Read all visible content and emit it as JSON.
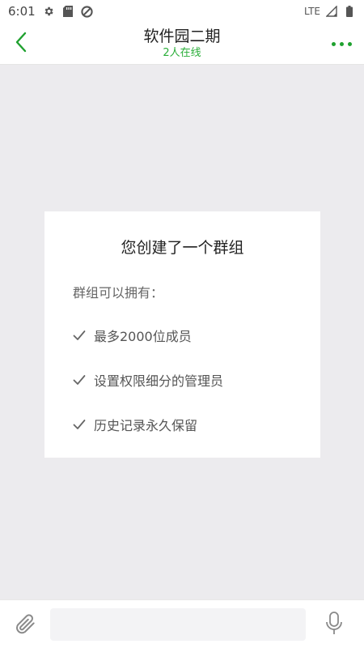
{
  "status_bar": {
    "time": "6:01",
    "network": "LTE",
    "icons": [
      "gear-icon",
      "sd-card-icon",
      "sync-icon",
      "signal-icon",
      "battery-icon"
    ]
  },
  "header": {
    "title": "软件园二期",
    "subtitle": "2人在线",
    "back_icon": "chevron-left-icon",
    "more_icon": "more-dots-icon",
    "accent_color": "#1fa12f"
  },
  "group_card": {
    "title": "您创建了一个群组",
    "intro": "群组可以拥有：",
    "features": [
      "最多2000位成员",
      "设置权限细分的管理员",
      "历史记录永久保留"
    ]
  },
  "input_bar": {
    "attach_icon": "paperclip-icon",
    "placeholder": "",
    "value": "",
    "mic_icon": "microphone-icon"
  }
}
